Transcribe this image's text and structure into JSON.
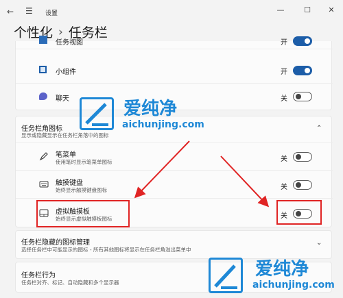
{
  "window": {
    "title": "设置",
    "back_glyph": "←",
    "menu_glyph": "☰",
    "minimize": "—",
    "maximize": "☐",
    "close": "✕"
  },
  "breadcrumb": {
    "parent": "个性化",
    "separator": "›",
    "current": "任务栏"
  },
  "top_items": [
    {
      "label": "任务视图",
      "state": "开",
      "on": true
    },
    {
      "label": "小组件",
      "state": "开",
      "on": true
    },
    {
      "label": "聊天",
      "state": "关",
      "on": false
    }
  ],
  "corner_icons": {
    "title": "任务栏角图标",
    "subtitle": "显示或隐藏显示在任务栏角落中的图标",
    "expanded_glyph": "⌃",
    "items": [
      {
        "label": "笔菜单",
        "subtitle": "使用笔时显示笔菜单图标",
        "state": "关",
        "on": false,
        "icon": "pen-icon"
      },
      {
        "label": "触摸键盘",
        "subtitle": "始终显示触摸键盘图标",
        "state": "关",
        "on": false,
        "icon": "keyboard-icon"
      },
      {
        "label": "虚拟触摸板",
        "subtitle": "始终显示虚拟触摸板图标",
        "state": "关",
        "on": false,
        "icon": "touchpad-icon"
      }
    ]
  },
  "overflow": {
    "title": "任务栏隐藏的图标管理",
    "subtitle": "选择任务栏中可能显示的图标 - 所有其他图标将显示在任务栏角溢出菜单中",
    "collapsed_glyph": "⌄"
  },
  "behaviors": {
    "title": "任务栏行为",
    "subtitle": "任务栏对齐、标记、自动隐藏和多个显示器"
  },
  "watermark": {
    "cn": "爱纯净",
    "en": "aichunjing.com",
    "color": "#1e88d6"
  },
  "colors": {
    "toggle_on": "#1c5da8",
    "highlight": "#e02424",
    "background": "#f3f3f3"
  }
}
